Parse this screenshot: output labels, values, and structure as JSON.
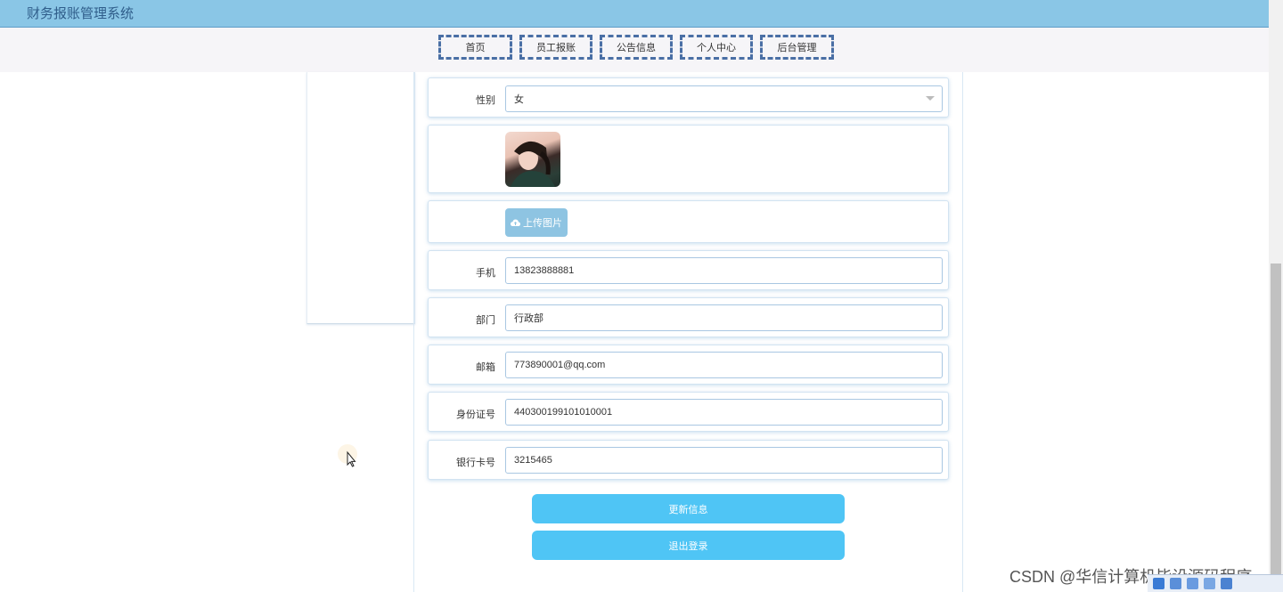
{
  "app": {
    "title": "财务报账管理系统"
  },
  "nav": {
    "items": [
      "首页",
      "员工报账",
      "公告信息",
      "个人中心",
      "后台管理"
    ]
  },
  "form": {
    "gender": {
      "label": "性别",
      "value": "女"
    },
    "upload": {
      "label": "上传图片"
    },
    "phone": {
      "label": "手机",
      "value": "13823888881"
    },
    "department": {
      "label": "部门",
      "value": "行政部"
    },
    "email": {
      "label": "邮箱",
      "value": "773890001@qq.com"
    },
    "id_number": {
      "label": "身份证号",
      "value": "440300199101010001"
    },
    "bank_card": {
      "label": "银行卡号",
      "value": "3215465"
    }
  },
  "buttons": {
    "update": "更新信息",
    "logout": "退出登录"
  },
  "watermark": "CSDN @华信计算机毕设源码程序",
  "colors": {
    "topbar": "#8ac6e6",
    "nav_border": "#4a6fa5",
    "primary_button": "#4fc5f5",
    "upload_button": "#8ec4e2"
  }
}
